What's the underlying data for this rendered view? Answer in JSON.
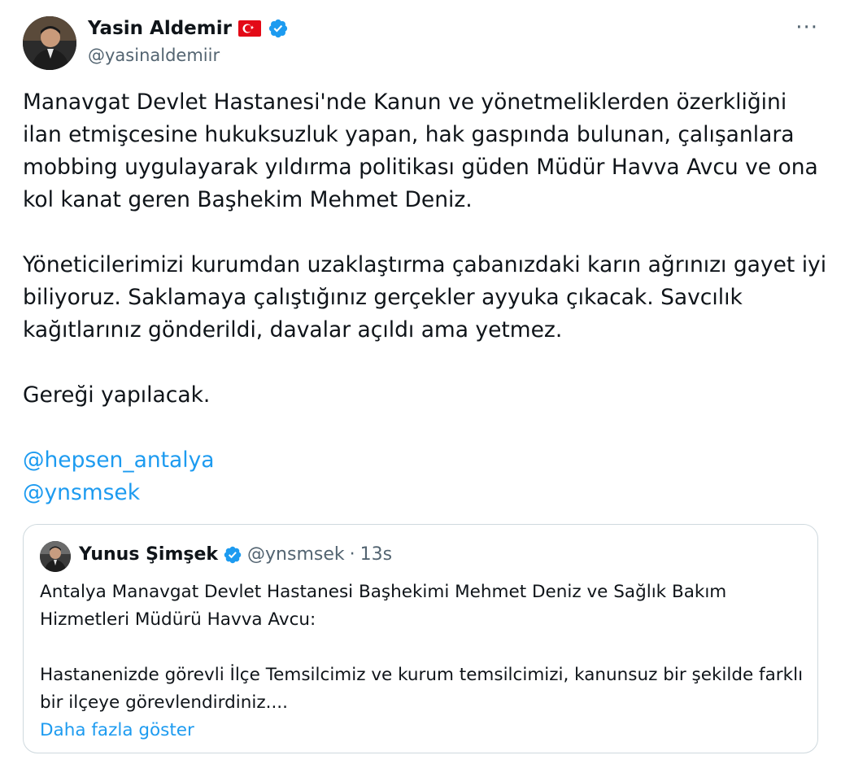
{
  "tweet": {
    "author_name": "Yasin Aldemir",
    "author_handle": "@yasinaldemiir",
    "flag_icon": "turkey-flag-icon",
    "more_label": "···",
    "paragraphs": [
      "Manavgat Devlet Hastanesi'nde Kanun ve yönetmeliklerden özerkliğini ilan etmişcesine hukuksuzluk yapan, hak gaspında bulunan, çalışanlara mobbing uygulayarak yıldırma politikası güden Müdür Havva Avcu ve ona kol kanat geren Başhekim Mehmet Deniz.",
      "Yöneticilerimizi kurumdan uzaklaştırma çabanızdaki karın ağrınızı gayet iyi biliyoruz. Saklamaya çalıştığınız gerçekler ayyuka çıkacak. Savcılık kağıtlarınız gönderildi, davalar açıldı ama yetmez.",
      "Gereği yapılacak."
    ],
    "mentions": [
      "@hepsen_antalya",
      "@ynsmsek"
    ]
  },
  "quote": {
    "author_name": "Yunus Şimşek",
    "author_handle": "@ynsmsek",
    "separator": "·",
    "time": "13s",
    "paragraphs": [
      "Antalya Manavgat Devlet Hastanesi Başhekimi Mehmet Deniz ve Sağlık Bakım Hizmetleri Müdürü Havva Avcu:",
      "Hastanenizde görevli İlçe Temsilcimiz ve kurum temsilcimizi, kanunsuz bir şekilde farklı bir ilçeye görevlendirdiniz...."
    ],
    "show_more": "Daha fazla göster"
  },
  "colors": {
    "link": "#1d9bf0",
    "secondary_text": "#536471",
    "border": "#cfd9de",
    "verified": "#1d9bf0",
    "flag_red": "#e30a17"
  }
}
